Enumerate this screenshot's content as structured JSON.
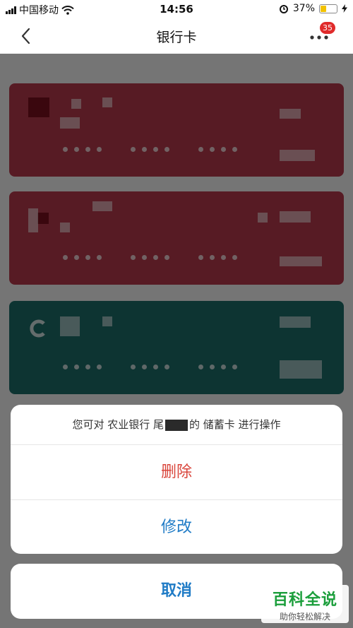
{
  "status_bar": {
    "carrier": "中国移动",
    "time": "14:56",
    "battery": "37%",
    "battery_level": 0.37
  },
  "nav": {
    "title": "银行卡",
    "badge_count": "35"
  },
  "cards": [
    {
      "color": "#b73a4b",
      "mask": "•••• •••• ••••"
    },
    {
      "color": "#b73a4b",
      "mask": "•••• •••• ••••"
    },
    {
      "color": "#1d6e6a",
      "mask": "•••• •••• ••••"
    }
  ],
  "action_sheet": {
    "message_prefix": "您可对 农业银行 尾",
    "message_suffix": "的 储蓄卡 进行操作",
    "delete_label": "删除",
    "edit_label": "修改",
    "cancel_label": "取消"
  },
  "watermark": {
    "title": "百科全说",
    "subtitle": "助你轻松解决"
  },
  "colors": {
    "danger": "#d9453b",
    "primary": "#1f7bc6",
    "badge": "#e02b2b"
  }
}
